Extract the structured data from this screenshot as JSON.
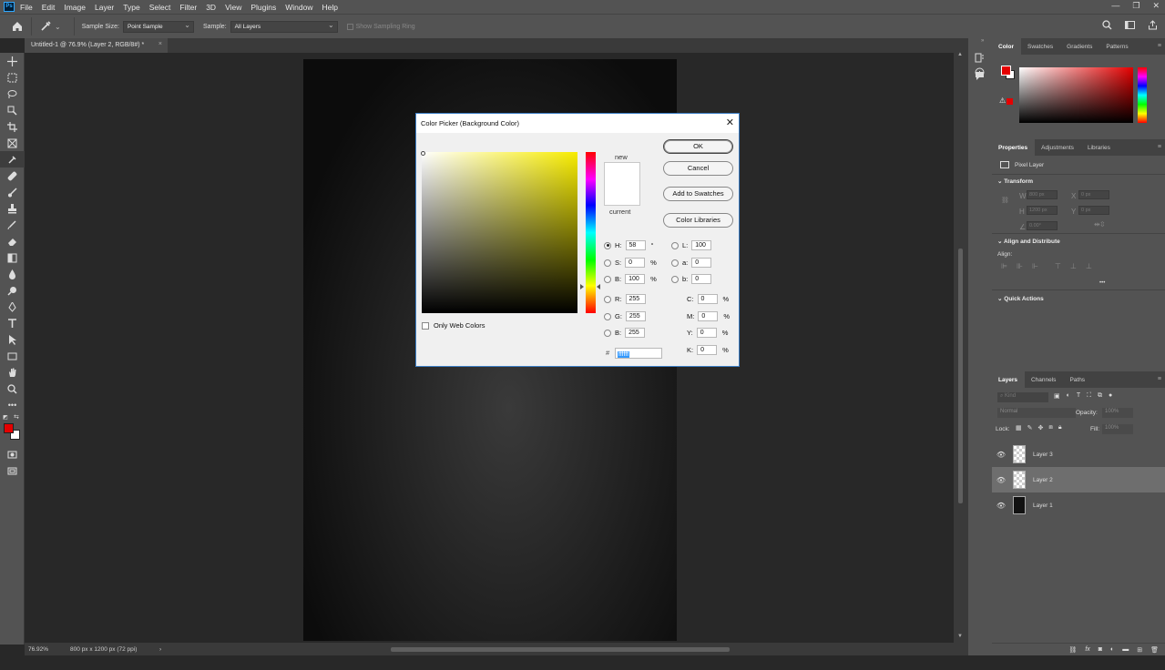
{
  "menubar": {
    "logo": "Ps",
    "items": [
      "File",
      "Edit",
      "Image",
      "Layer",
      "Type",
      "Select",
      "Filter",
      "3D",
      "View",
      "Plugins",
      "Window",
      "Help"
    ]
  },
  "options": {
    "sample_size_label": "Sample Size:",
    "sample_size": "Point Sample",
    "sample_label": "Sample:",
    "sample": "All Layers",
    "show_ring": "Show Sampling Ring"
  },
  "document": {
    "tab": "Untitled-1 @ 76.9% (Layer 2, RGB/8#) *",
    "tab_close": "×"
  },
  "status": {
    "zoom": "76.92%",
    "info": "800 px x 1200 px (72 ppi)",
    "arrow": "›"
  },
  "panels": {
    "color_tabs": [
      "Color",
      "Swatches",
      "Gradients",
      "Patterns"
    ],
    "props_tabs": [
      "Properties",
      "Adjustments",
      "Libraries"
    ],
    "props": {
      "kind": "Pixel Layer",
      "transform": "Transform",
      "w_label": "W",
      "w": "800 px",
      "x_label": "X",
      "x": "0 px",
      "h_label": "H",
      "h": "1200 px",
      "y_label": "Y",
      "y": "0 px",
      "angle": "0.00°",
      "align": "Align and Distribute",
      "align_label": "Align:",
      "more": "•••",
      "quick": "Quick Actions"
    },
    "layers_tabs": [
      "Layers",
      "Channels",
      "Paths"
    ],
    "layers_search": "Kind",
    "blend": "Normal",
    "opacity_label": "Opacity:",
    "opacity": "100%",
    "lock_label": "Lock:",
    "fill_label": "Fill:",
    "fill": "100%",
    "layers": [
      {
        "name": "Layer 3",
        "selected": false,
        "dark": false
      },
      {
        "name": "Layer 2",
        "selected": true,
        "dark": false
      },
      {
        "name": "Layer 1",
        "selected": false,
        "dark": true
      }
    ],
    "bottom_fx": "fx"
  },
  "dialog": {
    "title": "Color Picker (Background Color)",
    "new_label": "new",
    "current_label": "current",
    "ok": "OK",
    "cancel": "Cancel",
    "add_swatches": "Add to Swatches",
    "libraries": "Color Libraries",
    "only_web": "Only Web Colors",
    "hex_label": "#",
    "hex": "ffffff",
    "fields": {
      "H": {
        "label": "H:",
        "value": "58",
        "unit": "°"
      },
      "S": {
        "label": "S:",
        "value": "0",
        "unit": "%"
      },
      "Bv": {
        "label": "B:",
        "value": "100",
        "unit": "%"
      },
      "R": {
        "label": "R:",
        "value": "255"
      },
      "G": {
        "label": "G:",
        "value": "255"
      },
      "Bc": {
        "label": "B:",
        "value": "255"
      },
      "L": {
        "label": "L:",
        "value": "100"
      },
      "a": {
        "label": "a:",
        "value": "0"
      },
      "b": {
        "label": "b:",
        "value": "0"
      },
      "C": {
        "label": "C:",
        "value": "0",
        "unit": "%"
      },
      "M": {
        "label": "M:",
        "value": "0",
        "unit": "%"
      },
      "Y": {
        "label": "Y:",
        "value": "0",
        "unit": "%"
      },
      "K": {
        "label": "K:",
        "value": "0",
        "unit": "%"
      }
    }
  },
  "colors": {
    "foreground": "#e50000",
    "background": "#ffffff",
    "hue_selected": "#f7ec00"
  }
}
